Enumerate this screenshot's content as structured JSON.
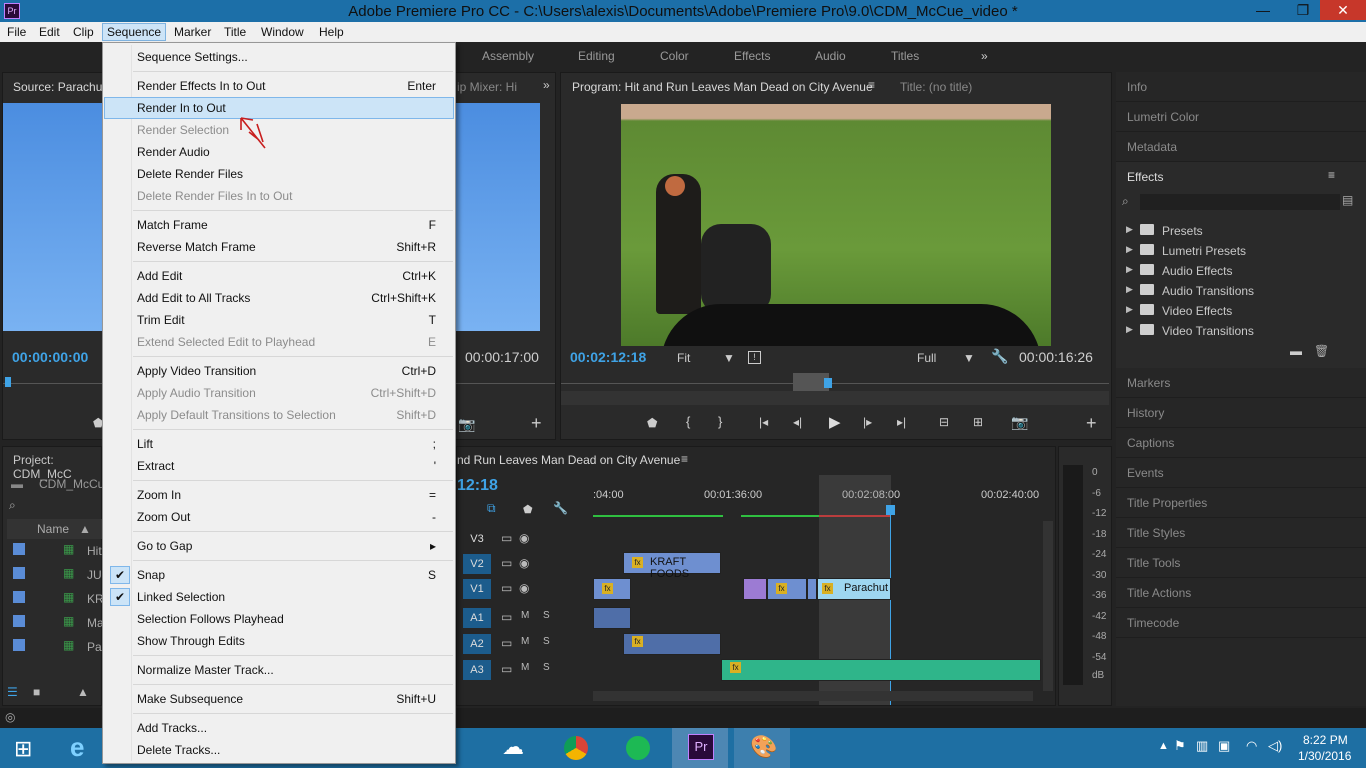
{
  "window": {
    "title": "Adobe Premiere Pro CC - C:\\Users\\alexis\\Documents\\Adobe\\Premiere Pro\\9.0\\CDM_McCue_video *",
    "app_icon": "Pr"
  },
  "menubar": [
    "File",
    "Edit",
    "Clip",
    "Sequence",
    "Marker",
    "Title",
    "Window",
    "Help"
  ],
  "workspaces": [
    "Assembly",
    "Editing",
    "Color",
    "Effects",
    "Audio",
    "Titles"
  ],
  "source": {
    "title": "Source: Parachute",
    "timecode_in": "00:00:00:00",
    "timecode_dur": "00:00:17:00",
    "mixer_tab": "ip Mixer: Hi"
  },
  "program": {
    "title": "Program: Hit and Run Leaves Man Dead on City Avenue",
    "title_tab": "Title: (no title)",
    "timecode": "00:02:12:18",
    "fit": "Fit",
    "quality": "Full",
    "duration": "00:00:16:26"
  },
  "project": {
    "title": "Project: CDM_McC",
    "file": "CDM_McCue",
    "col_name": "Name",
    "items": [
      "Hit",
      "JU",
      "KR",
      "Ma",
      "Par"
    ]
  },
  "timeline": {
    "seq_title": "nd Run Leaves Man Dead on City Avenue",
    "timecode": "12:18",
    "ruler": [
      ":04:00",
      "00:01:36:00",
      "00:02:08:00",
      "00:02:40:00"
    ],
    "tracks": [
      "V3",
      "V2",
      "V1",
      "A1",
      "A2",
      "A3"
    ],
    "clip_kraft": "KRAFT FOODS",
    "clip_parachute": "Parachut"
  },
  "meter_scale": [
    "0",
    "-6",
    "-12",
    "-18",
    "-24",
    "-30",
    "-36",
    "-42",
    "-48",
    "-54",
    "dB"
  ],
  "right_panels_top": [
    "Info",
    "Lumetri Color",
    "Metadata"
  ],
  "effects": {
    "title": "Effects",
    "items": [
      "Presets",
      "Lumetri Presets",
      "Audio Effects",
      "Audio Transitions",
      "Video Effects",
      "Video Transitions"
    ]
  },
  "right_panels_bottom": [
    "Markers",
    "History",
    "Captions",
    "Events",
    "Title Properties",
    "Title Styles",
    "Title Tools",
    "Title Actions",
    "Timecode"
  ],
  "menu": [
    {
      "label": "Sequence Settings...",
      "shortcut": "",
      "disabled": false
    },
    {
      "label": "Render Effects In to Out",
      "shortcut": "Enter",
      "disabled": false
    },
    {
      "label": "Render In to Out",
      "shortcut": "",
      "disabled": false
    },
    {
      "label": "Render Selection",
      "shortcut": "",
      "disabled": true
    },
    {
      "label": "Render Audio",
      "shortcut": "",
      "disabled": false
    },
    {
      "label": "Delete Render Files",
      "shortcut": "",
      "disabled": false
    },
    {
      "label": "Delete Render Files In to Out",
      "shortcut": "",
      "disabled": true
    },
    {
      "label": "Match Frame",
      "shortcut": "F",
      "disabled": false
    },
    {
      "label": "Reverse Match Frame",
      "shortcut": "Shift+R",
      "disabled": false
    },
    {
      "label": "Add Edit",
      "shortcut": "Ctrl+K",
      "disabled": false
    },
    {
      "label": "Add Edit to All Tracks",
      "shortcut": "Ctrl+Shift+K",
      "disabled": false
    },
    {
      "label": "Trim Edit",
      "shortcut": "T",
      "disabled": false
    },
    {
      "label": "Extend Selected Edit to Playhead",
      "shortcut": "E",
      "disabled": true
    },
    {
      "label": "Apply Video Transition",
      "shortcut": "Ctrl+D",
      "disabled": false
    },
    {
      "label": "Apply Audio Transition",
      "shortcut": "Ctrl+Shift+D",
      "disabled": true
    },
    {
      "label": "Apply Default Transitions to Selection",
      "shortcut": "Shift+D",
      "disabled": true
    },
    {
      "label": "Lift",
      "shortcut": ";",
      "disabled": false
    },
    {
      "label": "Extract",
      "shortcut": "'",
      "disabled": false
    },
    {
      "label": "Zoom In",
      "shortcut": "=",
      "disabled": false
    },
    {
      "label": "Zoom Out",
      "shortcut": "-",
      "disabled": false
    },
    {
      "label": "Go to Gap",
      "shortcut": "▸",
      "disabled": false
    },
    {
      "label": "Snap",
      "shortcut": "S",
      "disabled": false
    },
    {
      "label": "Linked Selection",
      "shortcut": "",
      "disabled": false
    },
    {
      "label": "Selection Follows Playhead",
      "shortcut": "",
      "disabled": false
    },
    {
      "label": "Show Through Edits",
      "shortcut": "",
      "disabled": false
    },
    {
      "label": "Normalize Master Track...",
      "shortcut": "",
      "disabled": false
    },
    {
      "label": "Make Subsequence",
      "shortcut": "Shift+U",
      "disabled": false
    },
    {
      "label": "Add Tracks...",
      "shortcut": "",
      "disabled": false
    },
    {
      "label": "Delete Tracks...",
      "shortcut": "",
      "disabled": false
    }
  ],
  "taskbar": {
    "time": "8:22 PM",
    "date": "1/30/2016"
  }
}
